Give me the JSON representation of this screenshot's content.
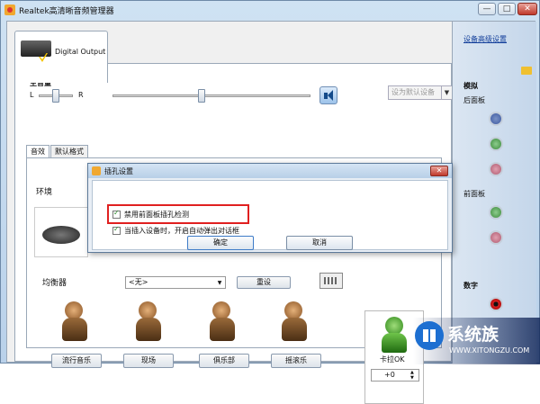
{
  "window": {
    "title": "Realtek高清晰音频管理器",
    "minimize": "—",
    "maximize": "□",
    "close": "✕"
  },
  "device_tab": {
    "label": "Digital Output"
  },
  "volume": {
    "title": "主音量",
    "left": "L",
    "right": "R",
    "balance": 0.5,
    "level": 0.45,
    "default_device": "设为默认设备"
  },
  "tabs": [
    "音效",
    "默认格式"
  ],
  "effects": {
    "environment_label": "环境",
    "equalizer_label": "均衡器",
    "equalizer_value": "<无>",
    "reset": "重设",
    "genres": [
      "流行音乐",
      "现场",
      "俱乐部",
      "摇滚乐"
    ],
    "karaoke_label": "卡拉OK",
    "karaoke_value": "+0"
  },
  "right_panel": {
    "advanced_link": "设备高级设置",
    "analog": "模拟",
    "back_panel": "后面板",
    "front_panel": "前面板",
    "digital": "数字"
  },
  "dialog": {
    "title": "插孔设置",
    "close": "✕",
    "option1": "禁用前面板插孔检测",
    "option2": "当插入设备时，开启自动弹出对话框",
    "ok": "确定",
    "cancel": "取消"
  },
  "watermark": {
    "text": "系统族",
    "url": "WWW.XITONGZU.COM"
  },
  "colors": {
    "accent": "#1d6fd1",
    "highlight": "#e02020"
  }
}
